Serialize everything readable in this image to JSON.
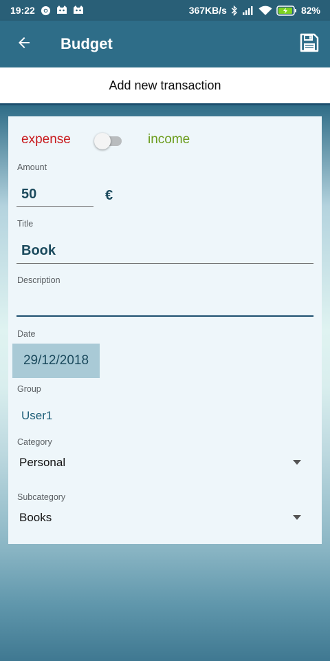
{
  "status_bar": {
    "time": "19:22",
    "net_speed": "367KB/s",
    "battery": "82%",
    "icons": [
      "chrome-icon",
      "notification-icon",
      "notification-icon",
      "bluetooth-icon",
      "signal-icon",
      "wifi-icon",
      "battery-charging-icon"
    ]
  },
  "appbar": {
    "title": "Budget",
    "back_icon": "back-arrow-icon",
    "save_icon": "save-icon"
  },
  "subheader": {
    "title": "Add new transaction"
  },
  "form": {
    "type_toggle": {
      "left_label": "expense",
      "right_label": "income",
      "state": "off"
    },
    "amount": {
      "label": "Amount",
      "value": "50",
      "currency": "€"
    },
    "title": {
      "label": "Title",
      "value": "Book"
    },
    "description": {
      "label": "Description",
      "value": ""
    },
    "date": {
      "label": "Date",
      "value": "29/12/2018"
    },
    "group": {
      "label": "Group",
      "value": "User1"
    },
    "category": {
      "label": "Category",
      "value": "Personal"
    },
    "subcategory": {
      "label": "Subcategory",
      "value": "Books"
    }
  },
  "colors": {
    "appbar": "#2e6d88",
    "expense": "#c8191c",
    "income": "#6a9b1b",
    "value_text": "#1b4a5d",
    "date_bg": "#a9cad6"
  }
}
